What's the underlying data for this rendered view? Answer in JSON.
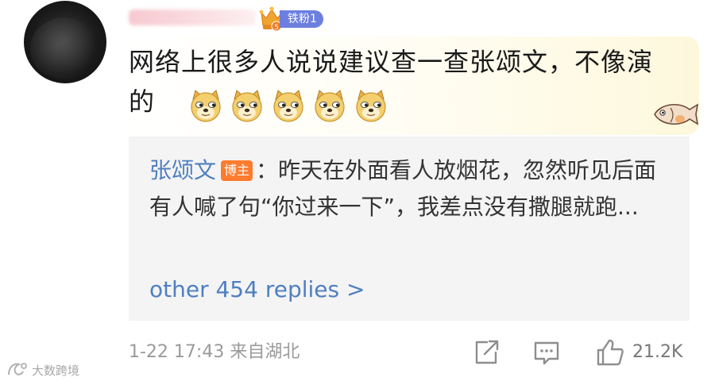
{
  "comment": {
    "username": "",
    "fan_badge": "铁粉1",
    "text": "网络上很多人说说建议查一查张颂文，不像演的",
    "emoji_count": 5
  },
  "reply": {
    "author": "张颂文",
    "author_badge": "博主",
    "separator": "：",
    "text": "昨天在外面看人放烟花，忽然听见后面有人喊了句“你过来一下”，我差点没有撒腿就跑...",
    "more_replies": "other 454 replies >"
  },
  "footer": {
    "timestamp": "1-22 17:43",
    "location": "来自湖北",
    "likes": "21.2K"
  },
  "watermark": {
    "text": "大数跨境"
  },
  "icons": [
    "crown-icon",
    "doge-emoji-icon",
    "fish-sticker-icon",
    "share-icon",
    "comment-icon",
    "like-icon",
    "watermark-logo-icon"
  ],
  "colors": {
    "link_blue": "#4f7fc0",
    "fan_badge": "#6c7fe0",
    "host_badge": "#ff7b2e",
    "quote_bg": "#f4f4f4",
    "meta_gray": "#9a9a9a"
  }
}
